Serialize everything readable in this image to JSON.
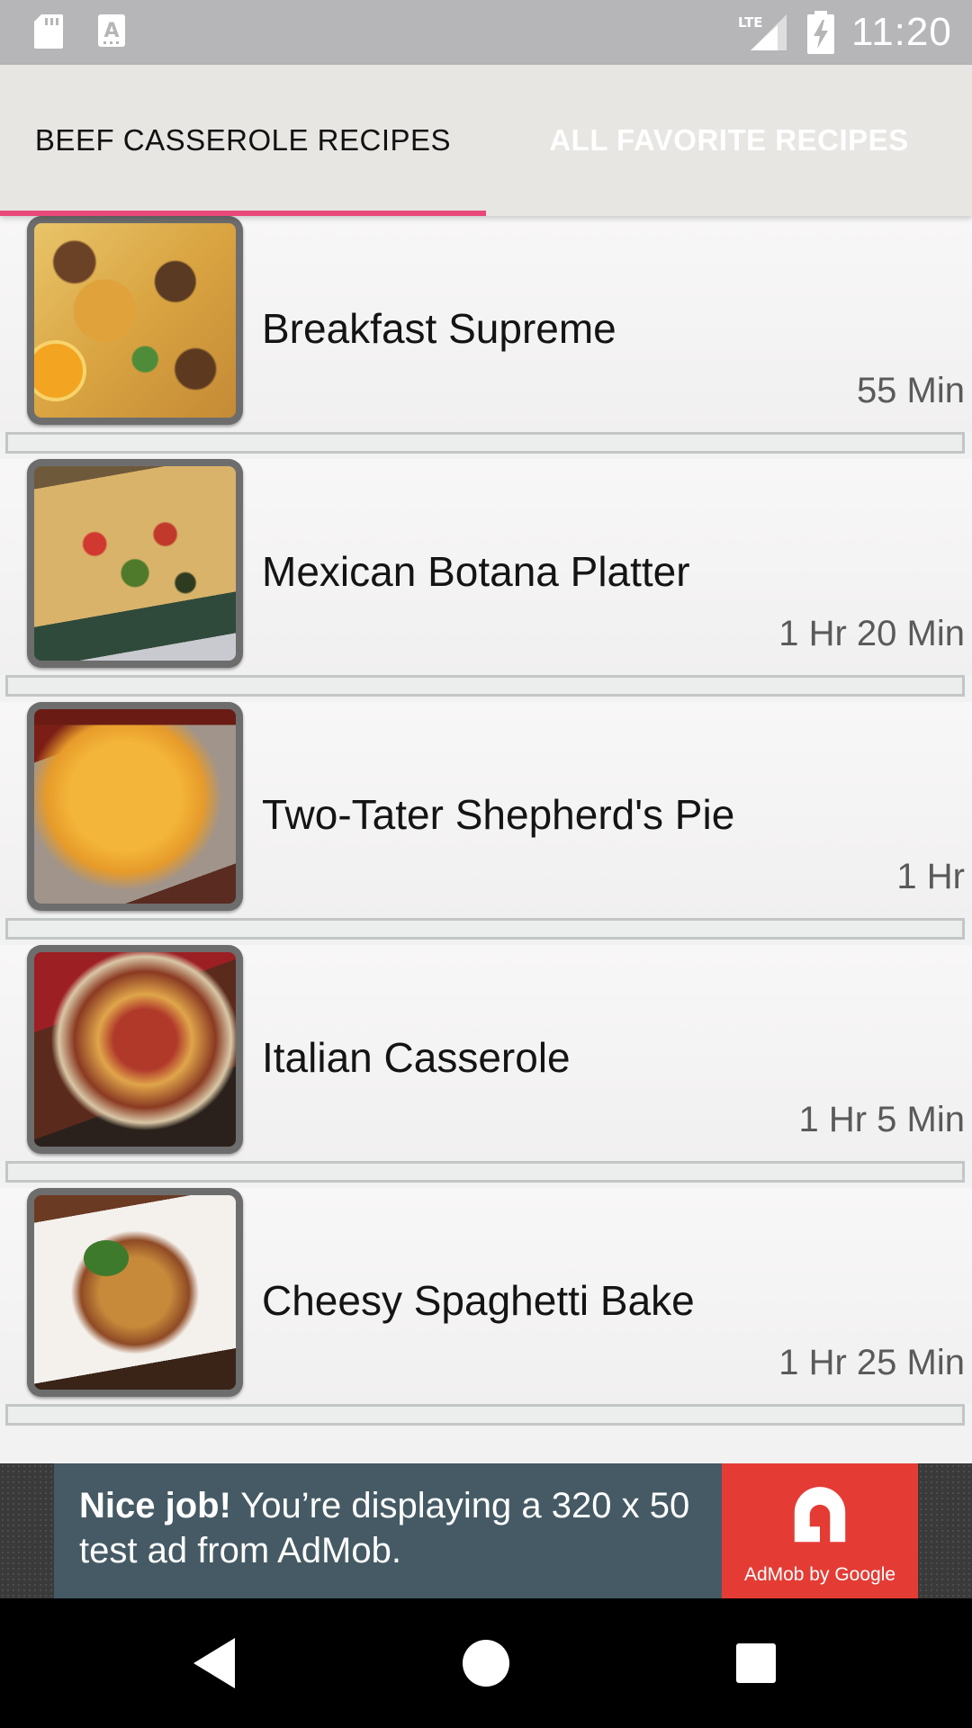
{
  "status_bar": {
    "time": "11:20",
    "network": "LTE",
    "notification_icons": [
      "sd-card-icon",
      "font-a-icon"
    ],
    "color": "#b6b6b9"
  },
  "tabs": [
    {
      "label": "BEEF CASSEROLE RECIPES",
      "selected": true
    },
    {
      "label": "ALL FAVORITE RECIPES",
      "selected": false
    }
  ],
  "accent_color": "#e9487a",
  "recipes": [
    {
      "title": "Breakfast Supreme",
      "time": "55 Min"
    },
    {
      "title": "Mexican Botana Platter",
      "time": "1 Hr 20 Min"
    },
    {
      "title": "Two-Tater Shepherd's Pie",
      "time": "1 Hr"
    },
    {
      "title": "Italian Casserole",
      "time": "1 Hr 5 Min"
    },
    {
      "title": "Cheesy Spaghetti Bake",
      "time": "1 Hr 25 Min"
    }
  ],
  "ad": {
    "bold": "Nice job!",
    "text": " You’re displaying a 320 x 50 test ad from AdMob.",
    "logo_caption": "AdMob by Google",
    "colors": {
      "banner": "#455a64",
      "logo": "#e43c35"
    }
  },
  "nav_bar": [
    "back-icon",
    "home-icon",
    "recents-icon"
  ]
}
